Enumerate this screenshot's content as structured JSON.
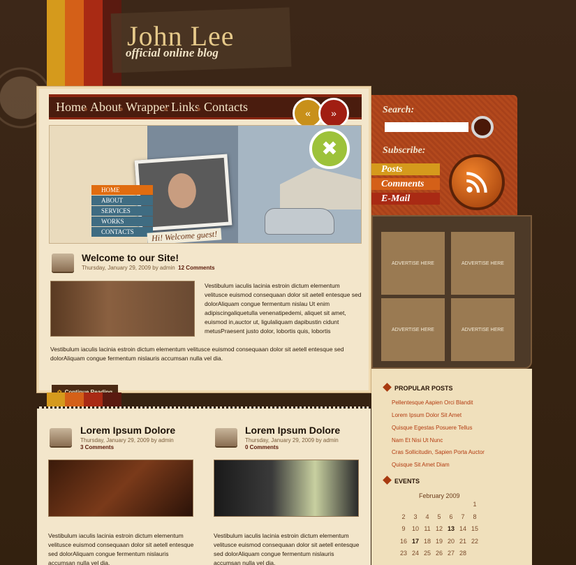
{
  "header": {
    "title": "John Lee",
    "subtitle": "official online blog"
  },
  "nav": {
    "items": [
      "Home",
      "About",
      "Wrapper",
      "Links",
      "Contacts"
    ]
  },
  "slider": {
    "prev_icon": "chevron-left-icon",
    "next_icon": "chevron-right-icon"
  },
  "banner": {
    "menu": [
      "HOME",
      "ABOUT",
      "SERVICES",
      "WORKS",
      "CONTACTS"
    ],
    "welcome": "Hi! Welcome guest!"
  },
  "featured": {
    "title": "Welcome to our Site!",
    "meta_date": "Thursday, January 29, 2009 by admin",
    "meta_comments": "12 Comments",
    "text_right": "Vestibulum iaculis lacinia estroin dictum elementum velitusce euismod consequaan dolor sit aetell entesque sed dolorAliquam congue fermentum nislau Ut enim adipiscingaliquetulla venenatipedemi, aliquet sit amet, euismod in,auctor ut, ligulaliquam dapibustin cidunt metusPraesent justo dolor, lobortis quis, lobortis",
    "text_full": "Vestibulum iaculis lacinia estroin dictum elementum velitusce euismod consequaan dolor sit aetell entesque sed dolorAliquam congue fermentum nislauris accumsan nulla vel dia.",
    "continue": "Continue Reading"
  },
  "posts": [
    {
      "title": "Lorem Ipsum Dolore",
      "meta_date": "Thursday, January 29, 2009 by admin",
      "comments": "3 Comments",
      "text": "Vestibulum iaculis lacinia estroin dictum elementum velitusce euismod consequaan dolor sit aetell entesque sed dolorAliquam congue fermentum nislauris accumsan nulla vel dia."
    },
    {
      "title": "Lorem Ipsum Dolore",
      "meta_date": "Thursday, January 29, 2009 by admin",
      "comments": "0 Comments",
      "text": "Vestibulum iaculis lacinia estroin dictum elementum velitusce euismod consequaan dolor sit aetell entesque sed dolorAliquam congue fermentum nislauris accumsan nulla vel dia."
    }
  ],
  "search": {
    "label": "Search:",
    "placeholder": ""
  },
  "subscribe": {
    "label": "Subscribe:",
    "items": [
      "Posts",
      "Comments",
      "E-Mail"
    ]
  },
  "ads": [
    "ADVERTISE HERE",
    "ADVERTISE HERE",
    "ADVERTISE HERE",
    "ADVERTISE HERE"
  ],
  "popular": {
    "title": "PROPULAR POSTS",
    "items": [
      "Pellentesque Aapien Orci Blandit",
      "Lorem Ipsum Dolor Sit Amet",
      "Quisque Egestas Posuere Tellus",
      "Nam Et Nisi Ut Nunc",
      "Cras Sollicitudin, Sapien Porta Auctor",
      "Quisque Sit Amet Diam"
    ]
  },
  "events": {
    "title": "EVENTS",
    "month": "February 2009",
    "rows": [
      [
        "",
        "",
        "",
        "",
        "",
        "",
        "1"
      ],
      [
        "2",
        "3",
        "4",
        "5",
        "6",
        "7",
        "8"
      ],
      [
        "9",
        "10",
        "11",
        "12",
        "13",
        "14",
        "15"
      ],
      [
        "16",
        "17",
        "18",
        "19",
        "20",
        "21",
        "22"
      ],
      [
        "23",
        "24",
        "25",
        "26",
        "27",
        "28",
        ""
      ]
    ],
    "bold": [
      "13",
      "17"
    ]
  },
  "colors": {
    "accent": "#8a2510",
    "background": "#3a2616",
    "card": "#f3e6cb"
  }
}
